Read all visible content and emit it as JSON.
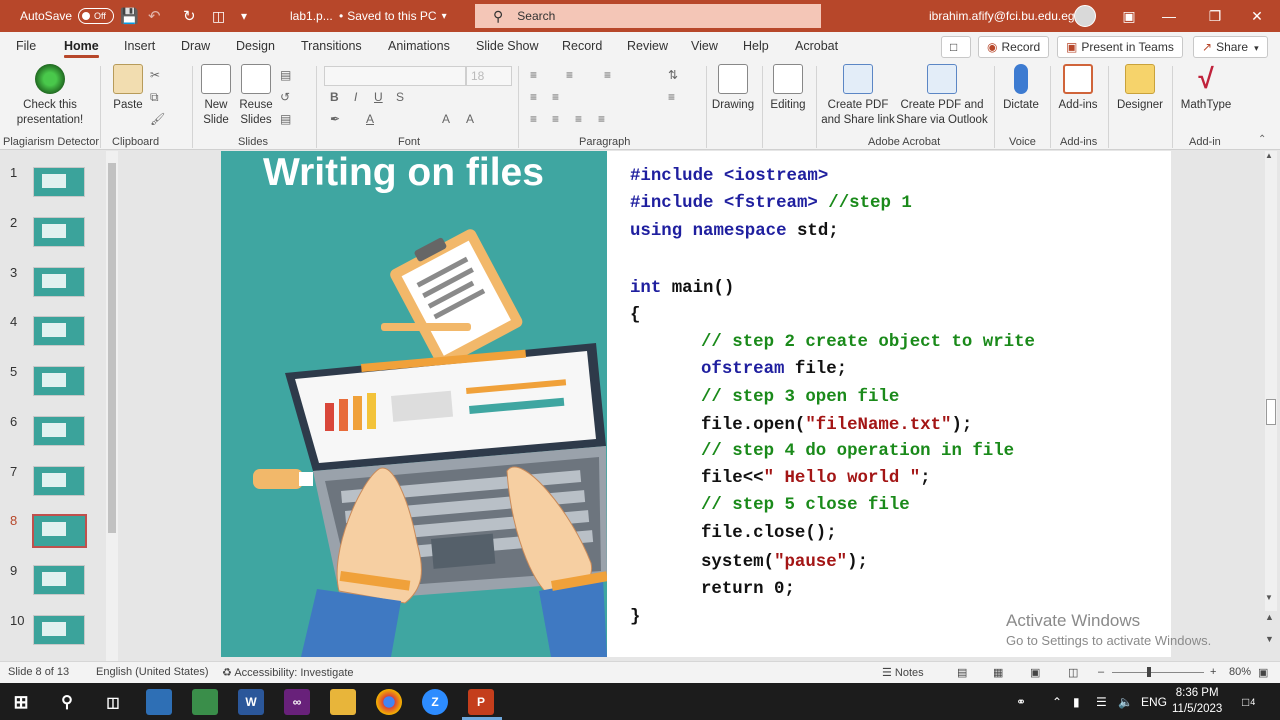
{
  "titlebar": {
    "autosave_label": "AutoSave",
    "autosave_state": "Off",
    "file_name": "lab1.p...",
    "save_status": "Saved to this PC",
    "save_status_icon": "chevron-down-icon",
    "search_placeholder": "Search",
    "account_email": "ibrahim.afify@fci.bu.edu.eg",
    "accent_color": "#b7472a"
  },
  "menu": {
    "tabs": [
      "File",
      "Home",
      "Insert",
      "Draw",
      "Design",
      "Transitions",
      "Animations",
      "Slide Show",
      "Record",
      "Review",
      "View",
      "Help",
      "Acrobat"
    ],
    "active_tab": "Home",
    "record_label": "Record",
    "present_teams_label": "Present in Teams",
    "share_label": "Share"
  },
  "ribbon": {
    "plagiarism": {
      "button": "Check this presentation!",
      "group": "Plagiarism Detector"
    },
    "clipboard": {
      "paste": "Paste",
      "group": "Clipboard"
    },
    "slides": {
      "new_slide": "New Slide",
      "reuse_slides": "Reuse Slides",
      "group": "Slides"
    },
    "font": {
      "group": "Font",
      "font_size": "18"
    },
    "paragraph": {
      "group": "Paragraph"
    },
    "drawing": {
      "label": "Drawing"
    },
    "editing": {
      "label": "Editing"
    },
    "acrobat": {
      "create_pdf": "Create PDF and Share link",
      "create_pdf_outlook": "Create PDF and Share via Outlook",
      "group": "Adobe Acrobat"
    },
    "voice": {
      "dictate": "Dictate",
      "group": "Voice"
    },
    "addins": {
      "addins": "Add-ins",
      "group": "Add-ins"
    },
    "designer": {
      "label": "Designer"
    },
    "mathtype": {
      "label": "MathType",
      "group": "Add-in"
    }
  },
  "thumbnails": [
    "1",
    "2",
    "3",
    "4",
    "5",
    "6",
    "7",
    "8",
    "9",
    "10"
  ],
  "selected_slide": 8,
  "slide": {
    "title": "Writing on files",
    "code": {
      "l1": "#include <iostream>",
      "l2a": "#include <fstream>",
      "l2b": " //step 1",
      "l3a": "using namespace",
      "l3b": " std;",
      "l5a": "int",
      "l5b": " main()",
      "l6": "{",
      "l7": "// step 2 create object to write",
      "l8a": "ofstream",
      "l8b": " file;",
      "l9": "// step 3 open file",
      "l10a": "file.open(",
      "l10b": "\"fileName.txt\"",
      "l10c": ");",
      "l11": "// step 4 do operation in file",
      "l12a": "file<<",
      "l12b": "\" Hello world \"",
      "l12c": ";",
      "l13": "// step 5 close file",
      "l14": "file.close();",
      "l15a": "system(",
      "l15b": "\"pause\"",
      "l15c": ");",
      "l16": "return 0;",
      "l17": "}"
    }
  },
  "watermark": {
    "line1": "Activate Windows",
    "line2": "Go to Settings to activate Windows."
  },
  "statusbar": {
    "slide_info": "Slide 8 of 13",
    "language": "English (United States)",
    "accessibility": "Accessibility: Investigate",
    "notes": "Notes",
    "zoom": "80%"
  },
  "taskbar": {
    "language": "ENG",
    "time": "8:36 PM",
    "date": "11/5/2023",
    "notification_count": "4"
  }
}
